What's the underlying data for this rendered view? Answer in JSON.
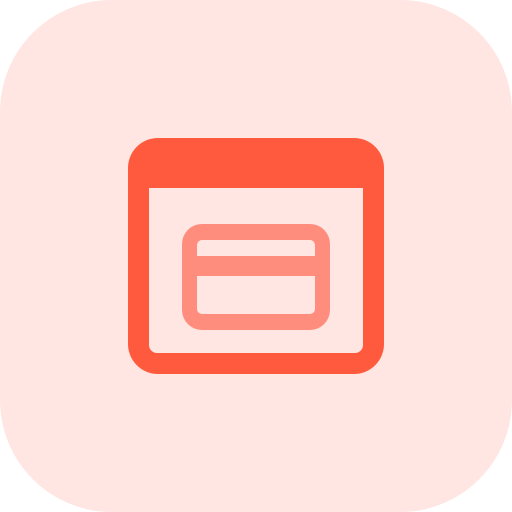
{
  "app_icon": {
    "name": "browser-payment-card-icon",
    "tile_color": "#FFE6E2",
    "primary_color": "#FF5A3D",
    "secondary_color": "#FF8D7E"
  }
}
